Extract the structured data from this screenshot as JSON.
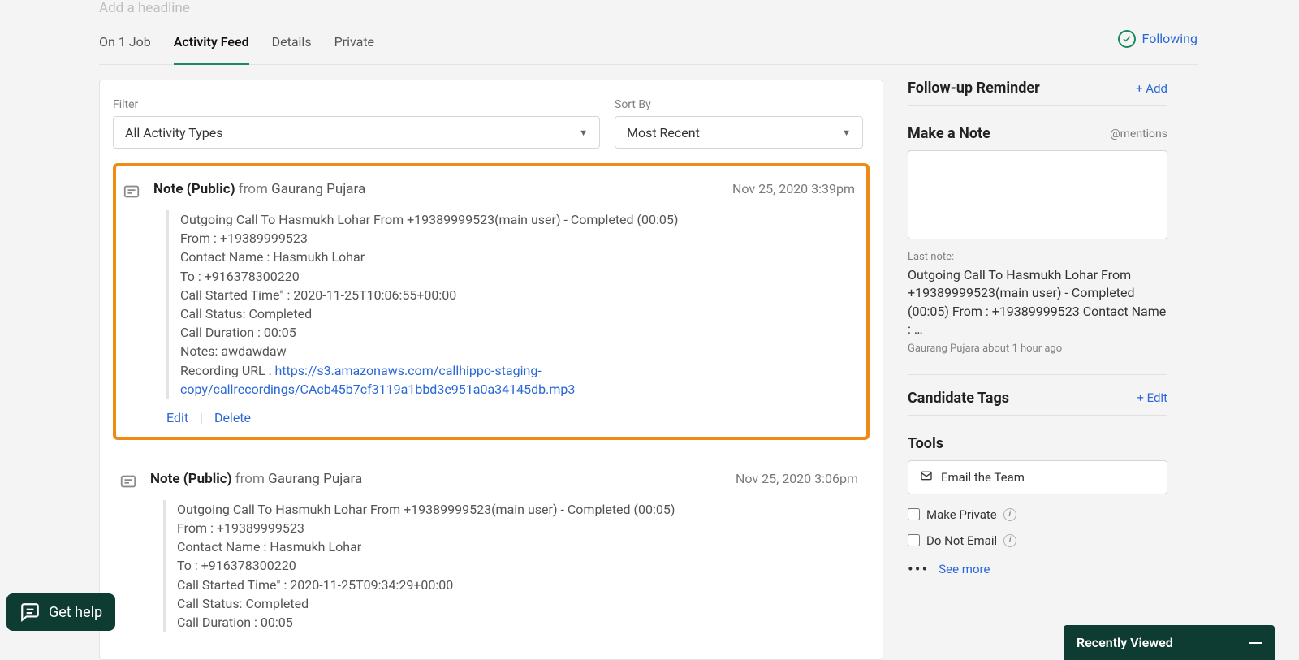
{
  "headline_placeholder": "Add a headline",
  "tabs": {
    "on_job": "On 1 Job",
    "activity_feed": "Activity Feed",
    "details": "Details",
    "private": "Private"
  },
  "following_label": "Following",
  "filter": {
    "label": "Filter",
    "value": "All Activity Types"
  },
  "sort": {
    "label": "Sort By",
    "value": "Most Recent"
  },
  "notes": [
    {
      "label": "Note (Public)",
      "from_word": "from",
      "author": "Gaurang Pujara",
      "time": "Nov 25, 2020 3:39pm",
      "lines": [
        "Outgoing Call To Hasmukh Lohar From +19389999523(main user) - Completed (00:05)",
        "From : +19389999523",
        "Contact Name : Hasmukh Lohar",
        "To : +916378300220",
        "Call Started Time\" : 2020-11-25T10:06:55+00:00",
        "Call Status: Completed",
        "Call Duration : 00:05",
        "Notes: awdawdaw"
      ],
      "recording_label": "Recording URL : ",
      "recording_url": "https://s3.amazonaws.com/callhippo-staging-copy/callrecordings/CAcb45b7cf3119a1bbd3e951a0a34145db.mp3",
      "edit": "Edit",
      "delete": "Delete"
    },
    {
      "label": "Note (Public)",
      "from_word": "from",
      "author": "Gaurang Pujara",
      "time": "Nov 25, 2020 3:06pm",
      "lines": [
        "Outgoing Call To Hasmukh Lohar From +19389999523(main user) - Completed (00:05)",
        "From : +19389999523",
        "Contact Name : Hasmukh Lohar",
        "To : +916378300220",
        "Call Started Time\" : 2020-11-25T09:34:29+00:00",
        "Call Status: Completed",
        "Call Duration : 00:05"
      ]
    }
  ],
  "sidebar": {
    "followup": {
      "title": "Follow-up Reminder",
      "add": "+ Add"
    },
    "make_note": {
      "title": "Make a Note",
      "mentions": "@mentions"
    },
    "last_note_label": "Last note:",
    "last_note_text": "Outgoing Call To Hasmukh Lohar From +19389999523(main user) - Completed (00:05) From : +19389999523 Contact Name : …",
    "last_note_meta": "Gaurang Pujara about 1 hour ago",
    "tags": {
      "title": "Candidate Tags",
      "edit": "+ Edit"
    },
    "tools_title": "Tools",
    "email_team": "Email the Team",
    "make_private": "Make Private",
    "do_not_email": "Do Not Email",
    "see_more": "See more"
  },
  "get_help": "Get help",
  "recently_viewed": "Recently Viewed"
}
